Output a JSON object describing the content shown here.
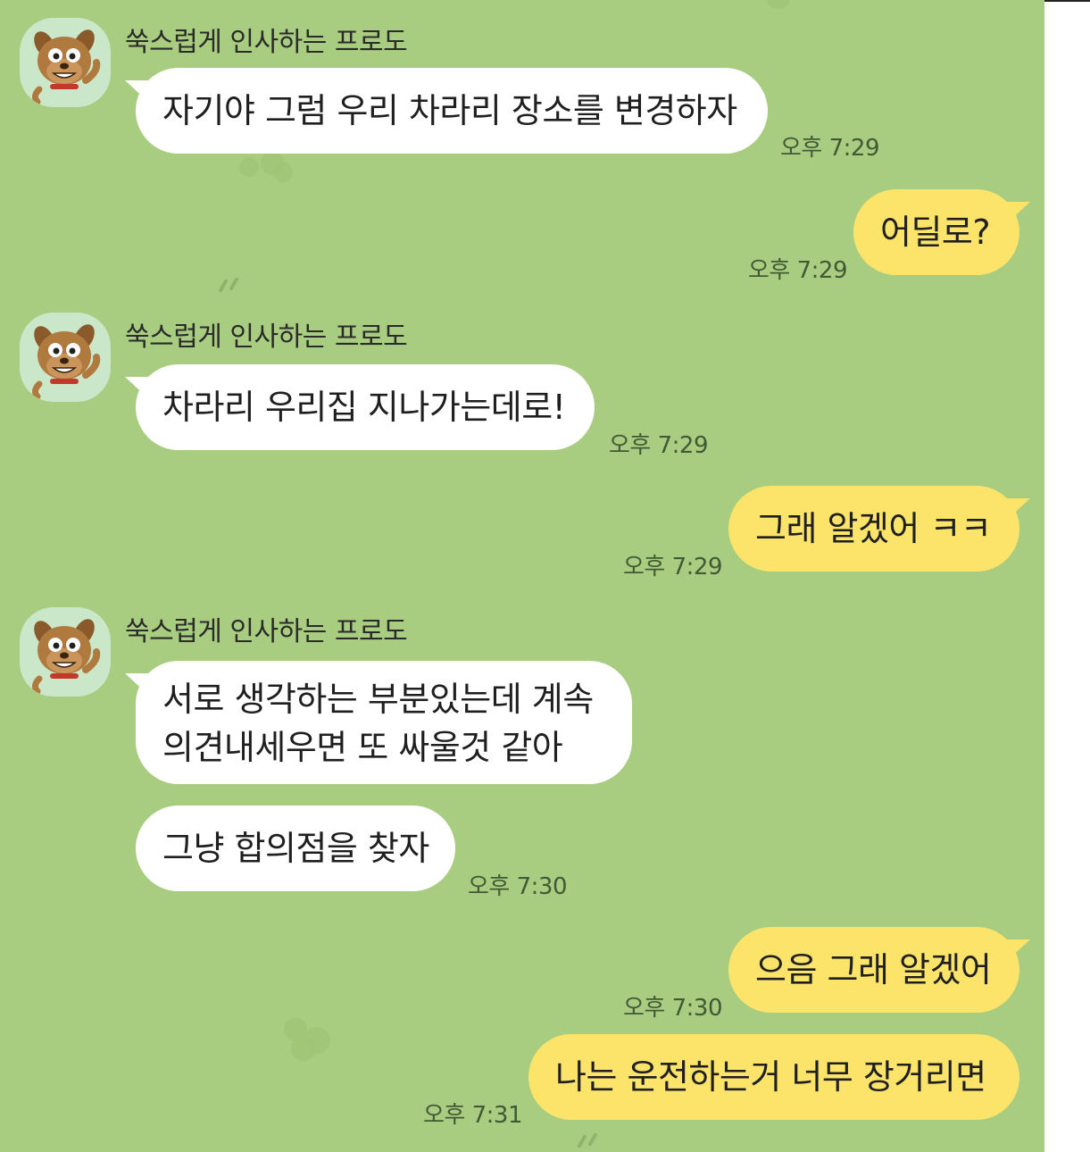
{
  "chat": {
    "sender_name": "쑥스럽게 인사하는 프로도",
    "avatar_icon": "frodo-dog-avatar-icon",
    "colors": {
      "background": "#a9cd80",
      "incoming_bubble": "#ffffff",
      "outgoing_bubble": "#fbe469"
    },
    "messages": [
      {
        "direction": "incoming",
        "text": "자기야 그럼 우리 차라리 장소를 변경하자",
        "time": "오후 7:29"
      },
      {
        "direction": "outgoing",
        "text": "어딜로?",
        "time": "오후 7:29"
      },
      {
        "direction": "incoming",
        "text": "차라리 우리집 지나가는데로!",
        "time": "오후 7:29"
      },
      {
        "direction": "outgoing",
        "text": "그래 알겠어 ㅋㅋ",
        "time": "오후 7:29"
      },
      {
        "direction": "incoming",
        "lines": [
          "서로 생각하는 부분있는데 계속",
          "의견내세우면 또 싸울것 같아"
        ]
      },
      {
        "direction": "incoming",
        "text": "그냥 합의점을 찾자",
        "time": "오후 7:30"
      },
      {
        "direction": "outgoing",
        "text": "으음 그래 알겠어",
        "time": "오후 7:30"
      },
      {
        "direction": "outgoing",
        "text": "나는 운전하는거 너무 장거리면",
        "time": "오후 7:31"
      }
    ]
  }
}
